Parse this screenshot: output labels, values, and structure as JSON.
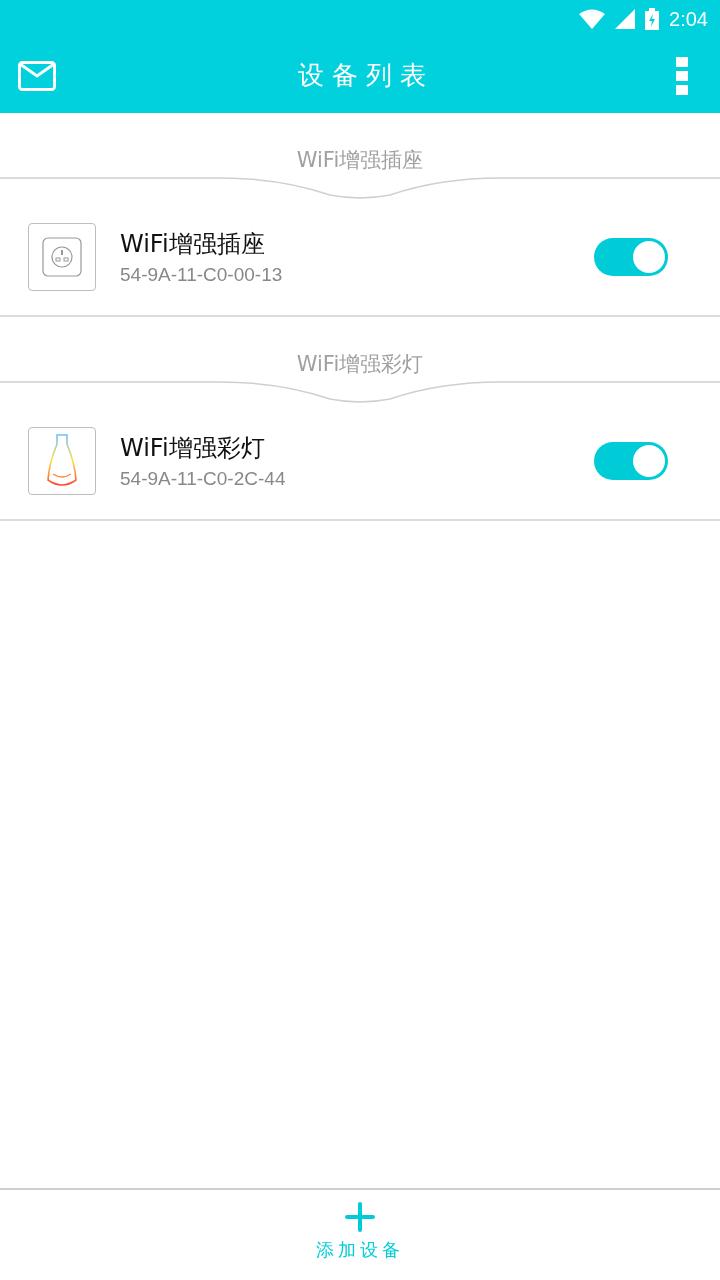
{
  "status_bar": {
    "time": "2:04"
  },
  "app_bar": {
    "title": "设备列表"
  },
  "groups": [
    {
      "title": "WiFi增强插座",
      "devices": [
        {
          "kind": "socket",
          "name": "WiFi增强插座",
          "mac": "54-9A-11-C0-00-13",
          "on": true
        }
      ]
    },
    {
      "title": "WiFi增强彩灯",
      "devices": [
        {
          "kind": "bulb",
          "name": "WiFi增强彩灯",
          "mac": "54-9A-11-C0-2C-44",
          "on": true
        }
      ]
    }
  ],
  "bottom_bar": {
    "add_label": "添加设备"
  }
}
